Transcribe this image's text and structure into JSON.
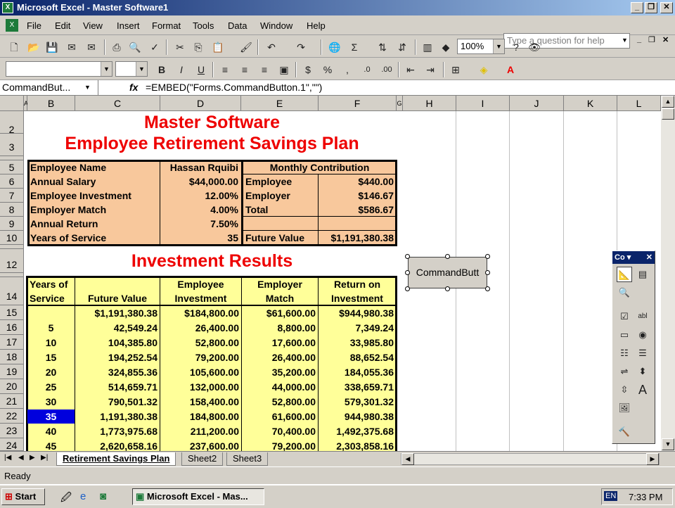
{
  "window": {
    "title": "Microsoft Excel - Master Software1",
    "app_icon": "X"
  },
  "menu": [
    "File",
    "Edit",
    "View",
    "Insert",
    "Format",
    "Tools",
    "Data",
    "Window",
    "Help"
  ],
  "help_placeholder": "Type a question for help",
  "toolbar": {
    "zoom": "100%",
    "font_name": "",
    "font_size": ""
  },
  "formula_bar": {
    "name_box": "CommandBut...",
    "fx": "fx",
    "formula": "=EMBED(\"Forms.CommandButton.1\",\"\")"
  },
  "columns": [
    "A",
    "B",
    "C",
    "D",
    "E",
    "F",
    "G",
    "H",
    "I",
    "J",
    "K",
    "L"
  ],
  "rows": [
    "2",
    "3",
    "5",
    "6",
    "7",
    "8",
    "9",
    "10",
    "12",
    "14",
    "15",
    "16",
    "17",
    "18",
    "19",
    "20",
    "21",
    "22",
    "23",
    "24"
  ],
  "headings": {
    "line1": "Master Software",
    "line2": "Employee Retirement Savings Plan",
    "results": "Investment Results"
  },
  "plan": {
    "left": [
      [
        "Employee Name",
        "Hassan Rquibi"
      ],
      [
        "Annual Salary",
        "$44,000.00"
      ],
      [
        "Employee Investment",
        "12.00%"
      ],
      [
        "Employer Match",
        "4.00%"
      ],
      [
        "Annual Return",
        "7.50%"
      ],
      [
        "Years of Service",
        "35"
      ]
    ],
    "monthly_title": "Monthly Contribution",
    "monthly": [
      [
        "Employee",
        "$440.00"
      ],
      [
        "Employer",
        "$146.67"
      ],
      [
        "Total",
        "$586.67"
      ]
    ],
    "future_label": "Future Value",
    "future_value": "$1,191,380.38"
  },
  "results": {
    "headers": [
      [
        "Years of",
        "Service"
      ],
      [
        "",
        "Future Value"
      ],
      [
        "Employee",
        "Investment"
      ],
      [
        "Employer",
        "Match"
      ],
      [
        "Return on",
        "Investment"
      ]
    ],
    "rows": [
      [
        "",
        "$1,191,380.38",
        "$184,800.00",
        "$61,600.00",
        "$944,980.38"
      ],
      [
        "5",
        "42,549.24",
        "26,400.00",
        "8,800.00",
        "7,349.24"
      ],
      [
        "10",
        "104,385.80",
        "52,800.00",
        "17,600.00",
        "33,985.80"
      ],
      [
        "15",
        "194,252.54",
        "79,200.00",
        "26,400.00",
        "88,652.54"
      ],
      [
        "20",
        "324,855.36",
        "105,600.00",
        "35,200.00",
        "184,055.36"
      ],
      [
        "25",
        "514,659.71",
        "132,000.00",
        "44,000.00",
        "338,659.71"
      ],
      [
        "30",
        "790,501.32",
        "158,400.00",
        "52,800.00",
        "579,301.32"
      ],
      [
        "35",
        "1,191,380.38",
        "184,800.00",
        "61,600.00",
        "944,980.38"
      ],
      [
        "40",
        "1,773,975.68",
        "211,200.00",
        "70,400.00",
        "1,492,375.68"
      ],
      [
        "45",
        "2,620,658.16",
        "237,600.00",
        "79,200.00",
        "2,303,858.16"
      ]
    ]
  },
  "command_button_label": "CommandButt",
  "controls_title": "Co",
  "sheets": [
    "Retirement Savings Plan",
    "Sheet2",
    "Sheet3"
  ],
  "status": "Ready",
  "taskbar": {
    "start": "Start",
    "task": "Microsoft Excel - Mas...",
    "lang": "EN",
    "time": "7:33 PM"
  },
  "colors": {
    "peach": "#f8c89c",
    "yellow": "#ffff99",
    "title_red": "#e00000",
    "selection_blue": "#0000dd"
  }
}
